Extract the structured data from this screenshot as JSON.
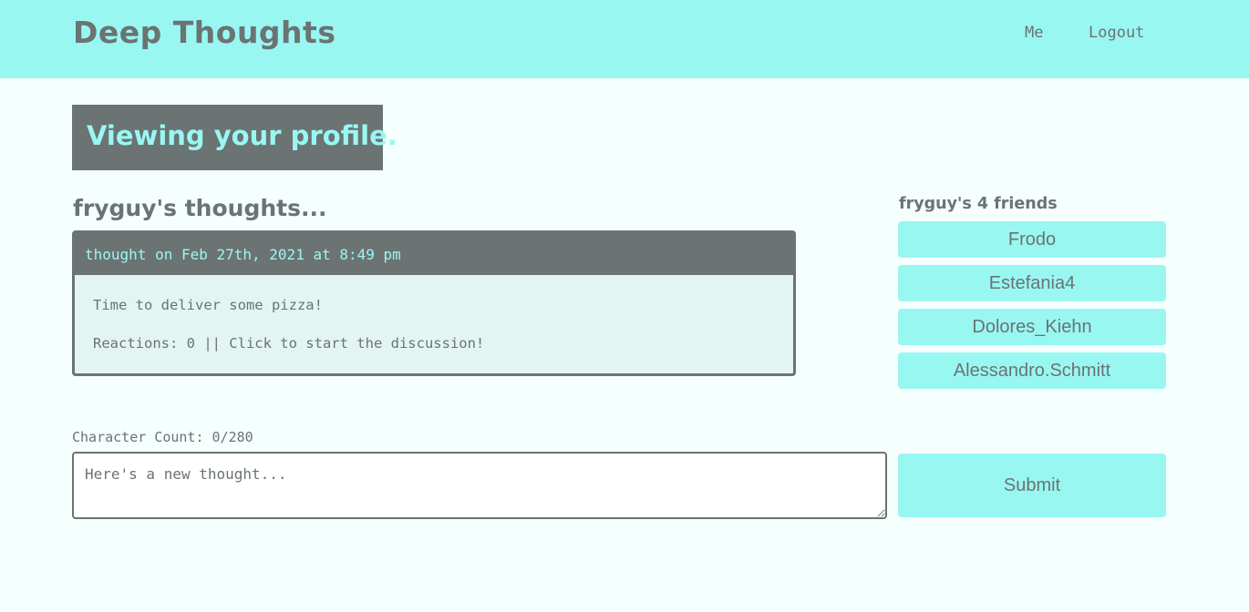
{
  "header": {
    "brand": "Deep Thoughts",
    "nav": {
      "me": "Me",
      "logout": "Logout"
    }
  },
  "profile": {
    "banner": "Viewing your profile.",
    "thoughts_title": "fryguy's thoughts...",
    "thoughts": [
      {
        "meta": "thought on Feb 27th, 2021 at 8:49 pm",
        "text": "Time to deliver some pizza!",
        "reactions": "Reactions: 0 || Click to start the discussion!"
      }
    ],
    "friends_title": "fryguy's 4 friends",
    "friends": [
      "Frodo",
      "Estefania4",
      "Dolores_Kiehn",
      "Alessandro.Schmitt"
    ]
  },
  "form": {
    "char_count": "Character Count: 0/280",
    "placeholder": "Here's a new thought...",
    "submit": "Submit"
  }
}
